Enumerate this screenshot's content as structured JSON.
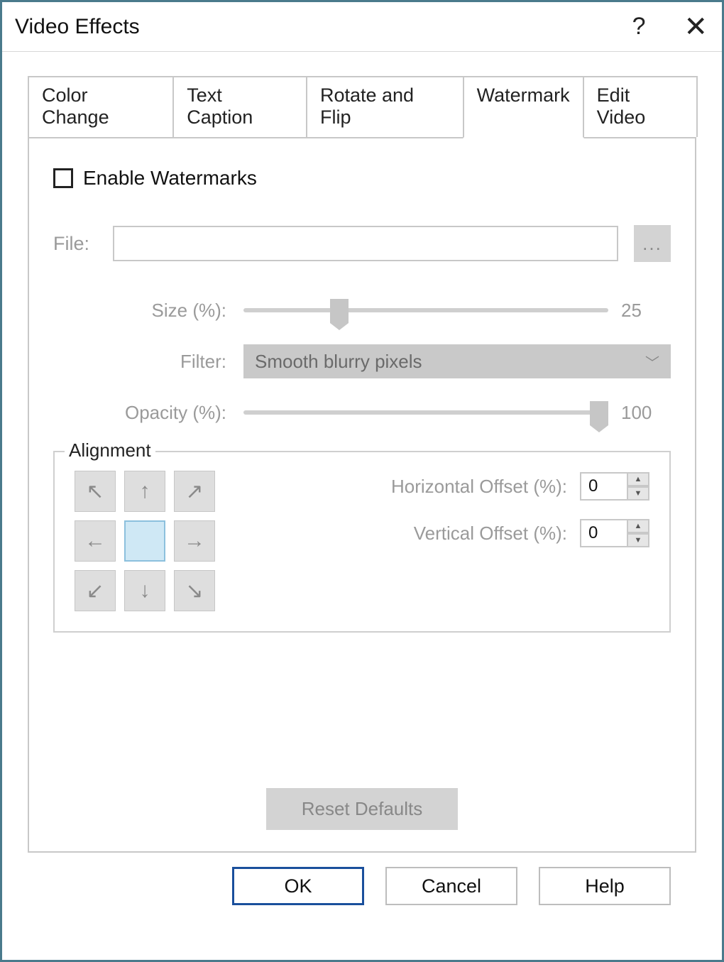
{
  "window": {
    "title": "Video Effects"
  },
  "tabs": {
    "0": {
      "label": "Color Change"
    },
    "1": {
      "label": "Text Caption"
    },
    "2": {
      "label": "Rotate and Flip"
    },
    "3": {
      "label": "Watermark"
    },
    "4": {
      "label": "Edit Video"
    }
  },
  "watermark": {
    "enable_label": "Enable Watermarks",
    "file_label": "File:",
    "file_value": "",
    "browse_label": "...",
    "size_label": "Size (%):",
    "size_value": "25",
    "size_percent": 25,
    "filter_label": "Filter:",
    "filter_value": "Smooth blurry pixels",
    "opacity_label": "Opacity (%):",
    "opacity_value": "100",
    "opacity_percent": 100
  },
  "alignment": {
    "legend": "Alignment",
    "hoffset_label": "Horizontal Offset (%):",
    "hoffset_value": "0",
    "voffset_label": "Vertical Offset (%):",
    "voffset_value": "0"
  },
  "buttons": {
    "reset": "Reset Defaults",
    "ok": "OK",
    "cancel": "Cancel",
    "help": "Help"
  }
}
